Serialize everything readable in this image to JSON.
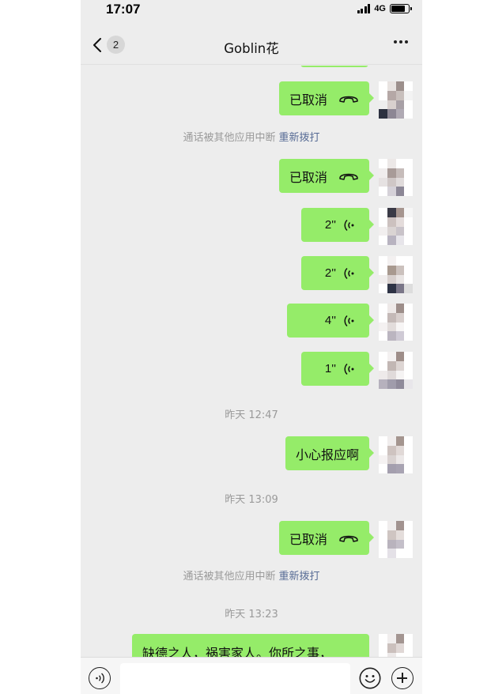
{
  "status_bar": {
    "time": "17:07",
    "network": "4G",
    "icons": [
      "signal-icon",
      "battery-icon"
    ]
  },
  "header": {
    "unread_count": "2",
    "title": "Goblin花",
    "icons": [
      "back-chevron-icon",
      "more-icon"
    ]
  },
  "labels": {
    "cancelled": "已取消",
    "interrupted": "通话被其他应用中断",
    "redial": "重新拨打"
  },
  "messages": {
    "m1_voice": "2''",
    "m2_voice": "2''",
    "m3_voice": "4''",
    "m4_voice": "1''",
    "ts1": "昨天 12:47",
    "m5_text": "小心报应啊",
    "ts2": "昨天 13:09",
    "ts3": "昨天 13:23",
    "m7_text": "缺德之人，祸害家人。你所之事，"
  },
  "input_bar": {
    "placeholder": "",
    "icons": [
      "voice-mode-icon",
      "emoji-icon",
      "plus-icon"
    ]
  },
  "colors": {
    "bubble_green": "#95ec69",
    "background": "#ededed",
    "link": "#576b95"
  }
}
